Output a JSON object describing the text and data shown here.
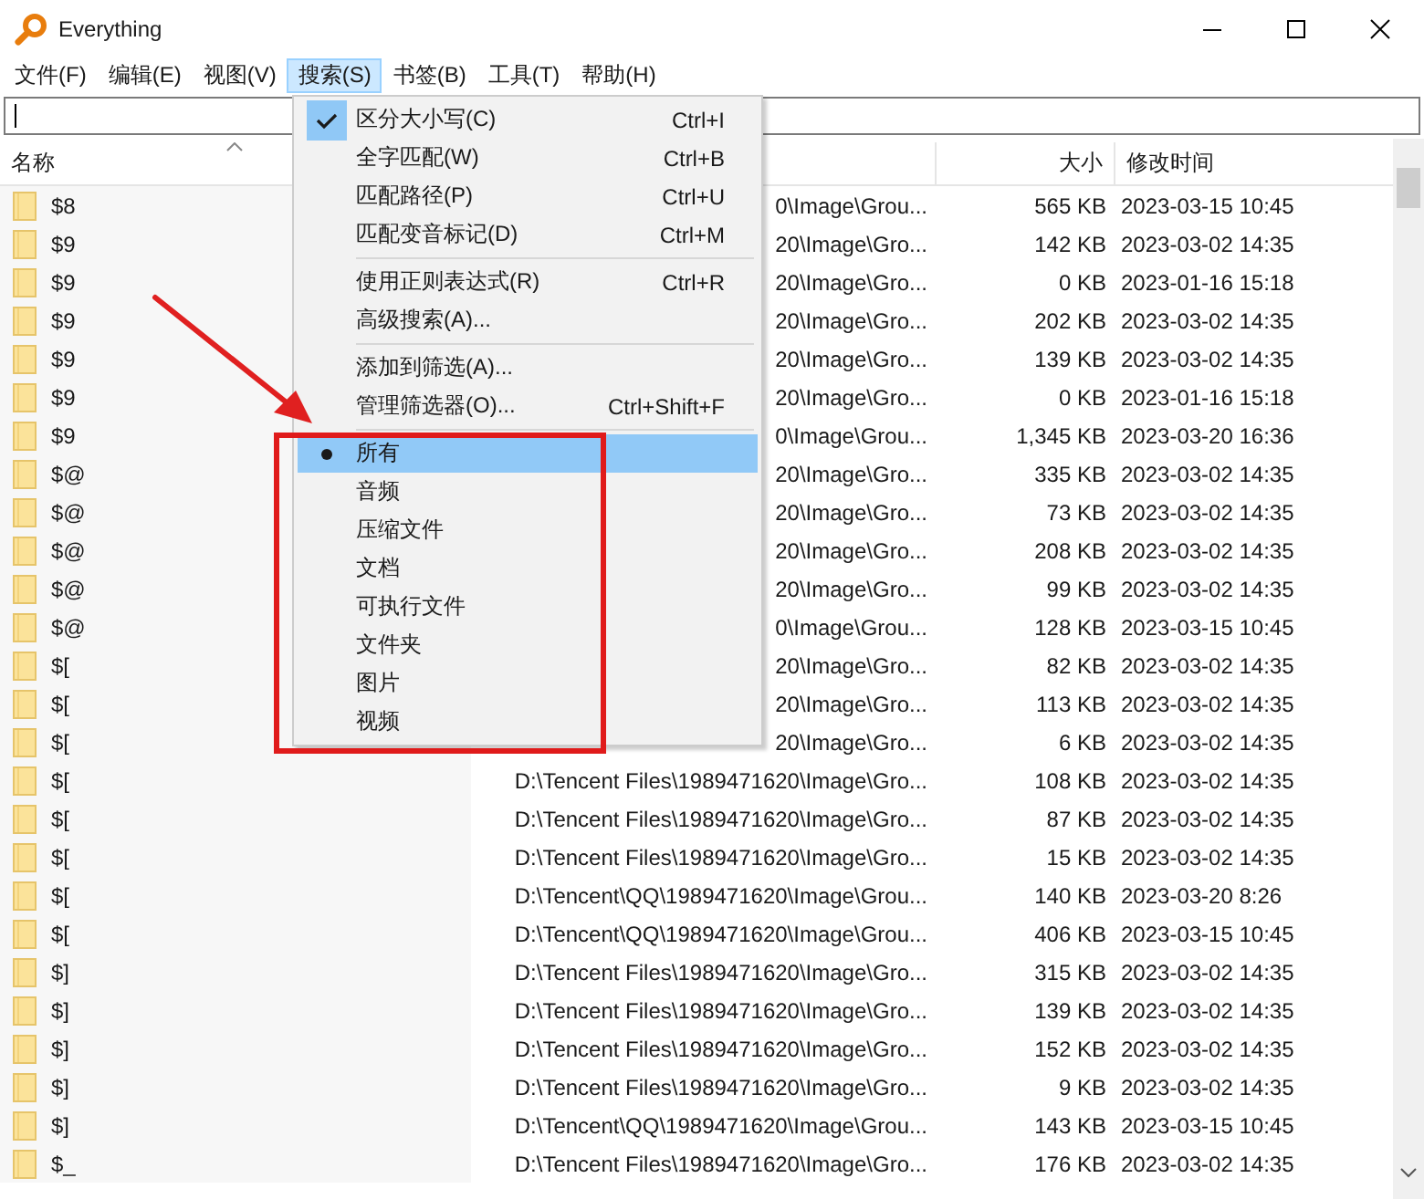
{
  "window": {
    "title": "Everything"
  },
  "menu_bar": [
    {
      "label": "文件(F)",
      "selected": false
    },
    {
      "label": "编辑(E)",
      "selected": false
    },
    {
      "label": "视图(V)",
      "selected": false
    },
    {
      "label": "搜索(S)",
      "selected": true
    },
    {
      "label": "书签(B)",
      "selected": false
    },
    {
      "label": "工具(T)",
      "selected": false
    },
    {
      "label": "帮助(H)",
      "selected": false
    }
  ],
  "search_menu": {
    "items": [
      {
        "kind": "check",
        "label": "区分大小写(C)",
        "shortcut": "Ctrl+I",
        "checked": true
      },
      {
        "kind": "check",
        "label": "全字匹配(W)",
        "shortcut": "Ctrl+B",
        "checked": false
      },
      {
        "kind": "check",
        "label": "匹配路径(P)",
        "shortcut": "Ctrl+U",
        "checked": false
      },
      {
        "kind": "check",
        "label": "匹配变音标记(D)",
        "shortcut": "Ctrl+M",
        "checked": false
      },
      {
        "kind": "separator"
      },
      {
        "kind": "check",
        "label": "使用正则表达式(R)",
        "shortcut": "Ctrl+R",
        "checked": false
      },
      {
        "kind": "command",
        "label": "高级搜索(A)..."
      },
      {
        "kind": "separator"
      },
      {
        "kind": "command",
        "label": "添加到筛选(A)..."
      },
      {
        "kind": "command",
        "label": "管理筛选器(O)...",
        "shortcut": "Ctrl+Shift+F"
      },
      {
        "kind": "separator"
      },
      {
        "kind": "radio",
        "label": "所有",
        "checked": true,
        "highlighted": true
      },
      {
        "kind": "radio",
        "label": "音频",
        "checked": false,
        "highlighted": false
      },
      {
        "kind": "radio",
        "label": "压缩文件",
        "checked": false,
        "highlighted": false
      },
      {
        "kind": "radio",
        "label": "文档",
        "checked": false,
        "highlighted": false
      },
      {
        "kind": "radio",
        "label": "可执行文件",
        "checked": false,
        "highlighted": false
      },
      {
        "kind": "radio",
        "label": "文件夹",
        "checked": false,
        "highlighted": false
      },
      {
        "kind": "radio",
        "label": "图片",
        "checked": false,
        "highlighted": false
      },
      {
        "kind": "radio",
        "label": "视频",
        "checked": false,
        "highlighted": false
      }
    ]
  },
  "table": {
    "columns": [
      {
        "label": "名称",
        "sorted": true
      },
      {
        "label": "大小",
        "sorted": false
      },
      {
        "label": "修改时间",
        "sorted": false
      }
    ],
    "rows": [
      {
        "name": "$8",
        "path": "0\\Image\\Grou...",
        "size": "565 KB",
        "modified": "2023-03-15 10:45"
      },
      {
        "name": "$9",
        "path": "20\\Image\\Gro...",
        "size": "142 KB",
        "modified": "2023-03-02 14:35"
      },
      {
        "name": "$9",
        "path": "20\\Image\\Gro...",
        "size": "0 KB",
        "modified": "2023-01-16 15:18"
      },
      {
        "name": "$9",
        "path": "20\\Image\\Gro...",
        "size": "202 KB",
        "modified": "2023-03-02 14:35"
      },
      {
        "name": "$9",
        "path": "20\\Image\\Gro...",
        "size": "139 KB",
        "modified": "2023-03-02 14:35"
      },
      {
        "name": "$9",
        "path": "20\\Image\\Gro...",
        "size": "0 KB",
        "modified": "2023-01-16 15:18"
      },
      {
        "name": "$9",
        "path": "0\\Image\\Grou...",
        "size": "1,345 KB",
        "modified": "2023-03-20 16:36"
      },
      {
        "name": "$@",
        "path": "20\\Image\\Gro...",
        "size": "335 KB",
        "modified": "2023-03-02 14:35"
      },
      {
        "name": "$@",
        "path": "20\\Image\\Gro...",
        "size": "73 KB",
        "modified": "2023-03-02 14:35"
      },
      {
        "name": "$@",
        "path": "20\\Image\\Gro...",
        "size": "208 KB",
        "modified": "2023-03-02 14:35"
      },
      {
        "name": "$@",
        "path": "20\\Image\\Gro...",
        "size": "99 KB",
        "modified": "2023-03-02 14:35"
      },
      {
        "name": "$@",
        "path": "0\\Image\\Grou...",
        "size": "128 KB",
        "modified": "2023-03-15 10:45"
      },
      {
        "name": "$[",
        "path": "20\\Image\\Gro...",
        "size": "82 KB",
        "modified": "2023-03-02 14:35"
      },
      {
        "name": "$[",
        "path": "20\\Image\\Gro...",
        "size": "113 KB",
        "modified": "2023-03-02 14:35"
      },
      {
        "name": "$[",
        "path": "20\\Image\\Gro...",
        "size": "6 KB",
        "modified": "2023-03-02 14:35"
      },
      {
        "name": "$[",
        "path": "D:\\Tencent Files\\1989471620\\Image\\Gro...",
        "size": "108 KB",
        "modified": "2023-03-02 14:35"
      },
      {
        "name": "$[",
        "path": "D:\\Tencent Files\\1989471620\\Image\\Gro...",
        "size": "87 KB",
        "modified": "2023-03-02 14:35"
      },
      {
        "name": "$[",
        "path": "D:\\Tencent Files\\1989471620\\Image\\Gro...",
        "size": "15 KB",
        "modified": "2023-03-02 14:35"
      },
      {
        "name": "$[",
        "path": "D:\\Tencent\\QQ\\1989471620\\Image\\Grou...",
        "size": "140 KB",
        "modified": "2023-03-20 8:26"
      },
      {
        "name": "$[",
        "path": "D:\\Tencent\\QQ\\1989471620\\Image\\Grou...",
        "size": "406 KB",
        "modified": "2023-03-15 10:45"
      },
      {
        "name": "$]",
        "path": "D:\\Tencent Files\\1989471620\\Image\\Gro...",
        "size": "315 KB",
        "modified": "2023-03-02 14:35"
      },
      {
        "name": "$]",
        "path": "D:\\Tencent Files\\1989471620\\Image\\Gro...",
        "size": "139 KB",
        "modified": "2023-03-02 14:35"
      },
      {
        "name": "$]",
        "path": "D:\\Tencent Files\\1989471620\\Image\\Gro...",
        "size": "152 KB",
        "modified": "2023-03-02 14:35"
      },
      {
        "name": "$]",
        "path": "D:\\Tencent Files\\1989471620\\Image\\Gro...",
        "size": "9 KB",
        "modified": "2023-03-02 14:35"
      },
      {
        "name": "$]",
        "path": "D:\\Tencent\\QQ\\1989471620\\Image\\Grou...",
        "size": "143 KB",
        "modified": "2023-03-15 10:45"
      },
      {
        "name": "$_",
        "path": "D:\\Tencent Files\\1989471620\\Image\\Gro...",
        "size": "176 KB",
        "modified": "2023-03-02 14:35"
      }
    ]
  }
}
